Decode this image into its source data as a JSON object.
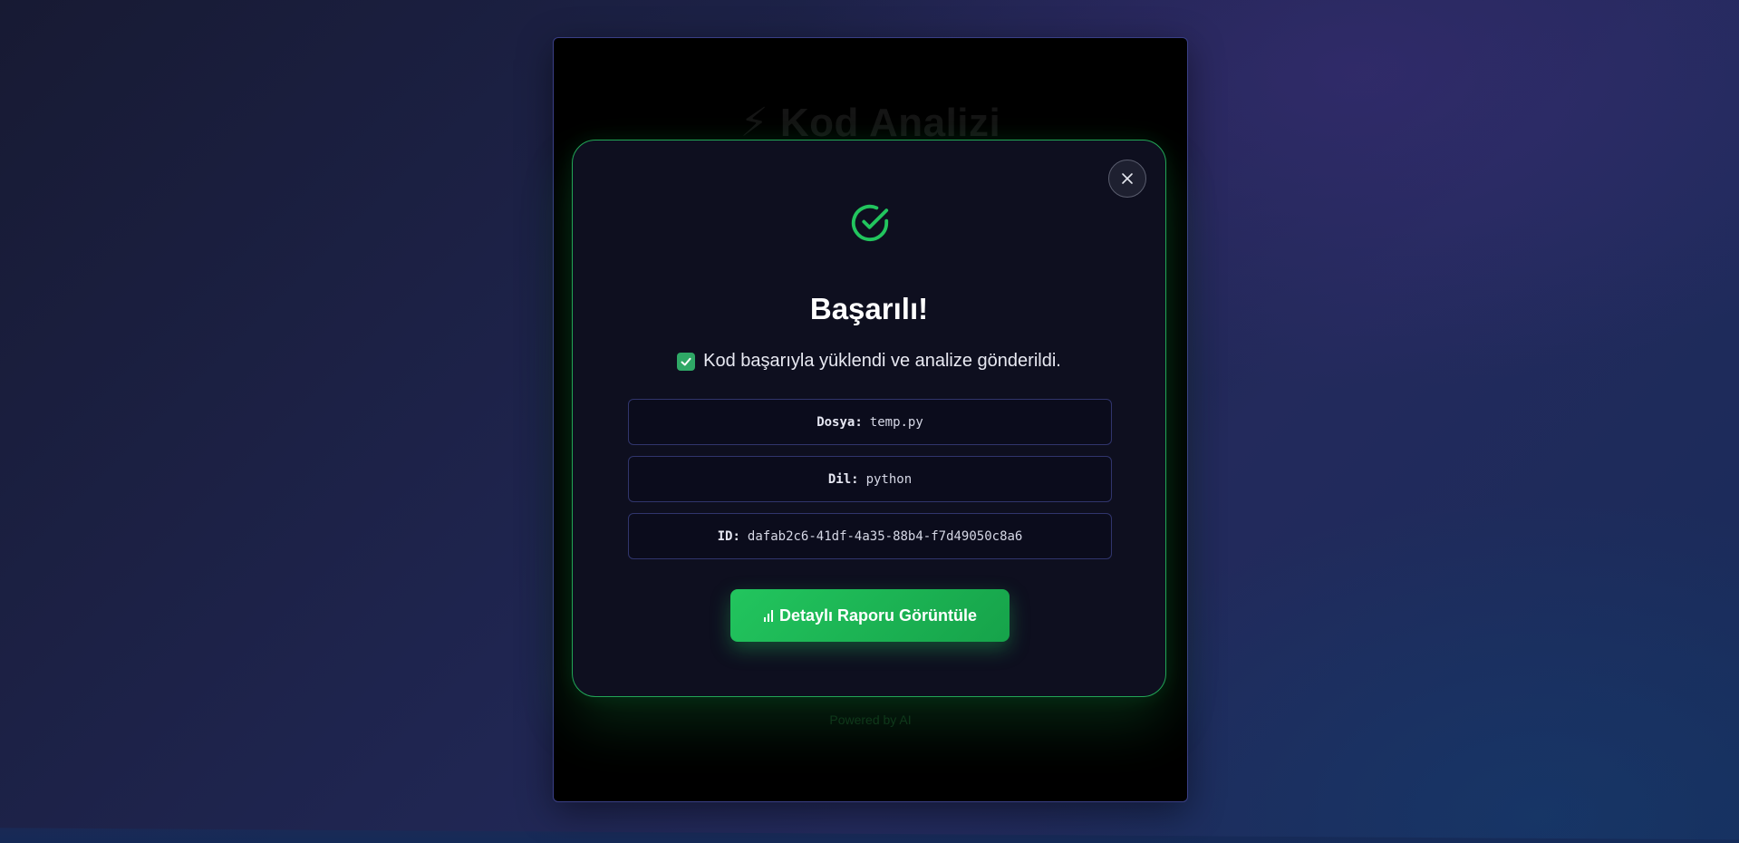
{
  "background_app": {
    "title": "⚡ Kod Analizi",
    "footer": "Powered by AI"
  },
  "modal": {
    "close_label": "×",
    "title": "Başarılı!",
    "message": "Kod başarıyla yüklendi ve analize gönderildi.",
    "info": [
      {
        "label": "Dosya:",
        "value": "temp.py"
      },
      {
        "label": "Dil:",
        "value": "python"
      },
      {
        "label": "ID:",
        "value": "dafab2c6-41df-4a35-88b4-f7d49050c8a6"
      }
    ],
    "report_button_label": "Detaylı Raporu Görüntüle"
  },
  "icons": {
    "success": "check-circle-icon",
    "message_check": "check-box-icon",
    "report": "bar-chart-icon",
    "close": "close-icon"
  },
  "colors": {
    "accent": "#22c55e",
    "accent_dark": "#16a34a",
    "modal_bg": "#0e0f1f",
    "modal_border": "#22a556"
  }
}
